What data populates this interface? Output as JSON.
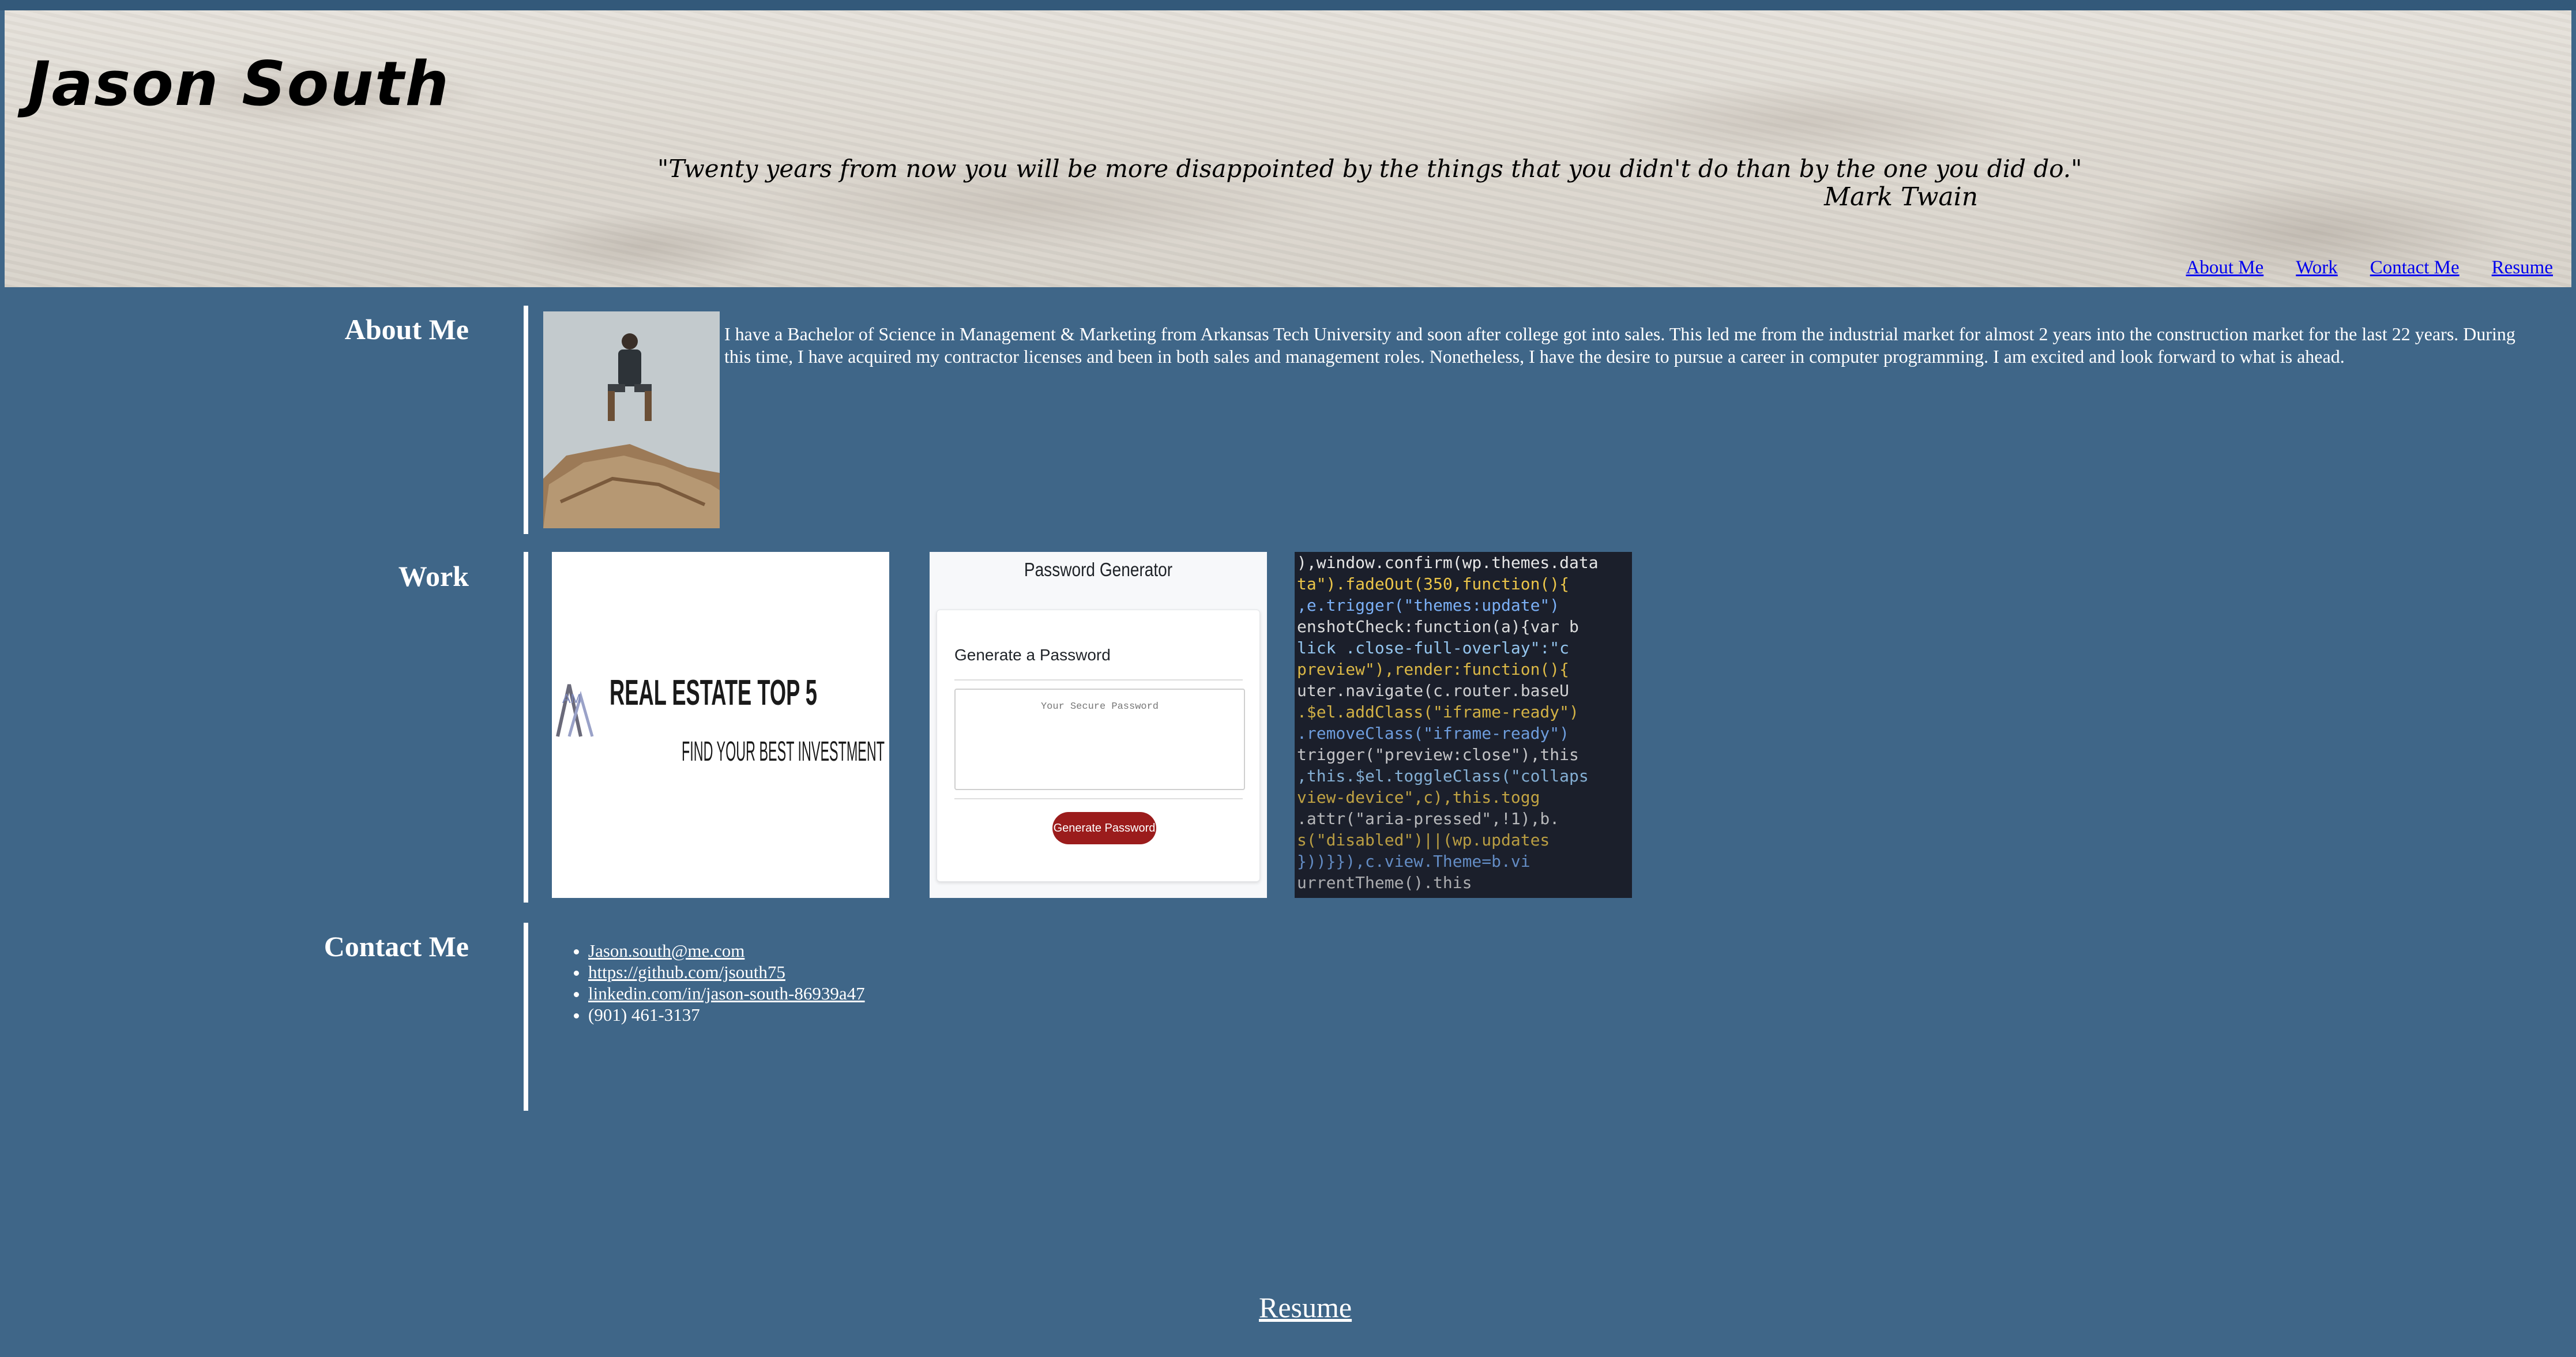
{
  "header": {
    "title": "Jason South",
    "quote": "\"Twenty years from now you will be more disappointed by the things that you didn't do than by the one you did do.\"",
    "quote_author": "Mark Twain"
  },
  "nav": {
    "items": [
      {
        "label": "About Me"
      },
      {
        "label": "Work"
      },
      {
        "label": "Contact Me"
      },
      {
        "label": "Resume"
      }
    ]
  },
  "about": {
    "heading": "About Me",
    "text": "I have a Bachelor of Science in Management & Marketing from Arkansas Tech University and soon after college got into sales. This led me from the industrial market for almost 2 years into the construction market for the last 22 years. During this time, I have acquired my contractor licenses and been in both sales and management roles. Nonetheless, I have the desire to pursue a career in computer programming. I am excited and look forward to what is ahead."
  },
  "work": {
    "heading": "Work",
    "projects": [
      {
        "title": "REAL ESTATE TOP 5",
        "subtitle": "FIND YOUR BEST INVESTMENT",
        "logo_text": "AM"
      },
      {
        "title": "Password Generator",
        "card_heading": "Generate a Password",
        "placeholder": "Your Secure Password",
        "button_label": "Generate Password",
        "button_color": "#9b1c1c"
      },
      {
        "code_lines": [
          "),window.confirm(wp.themes.data",
          "ta\").fadeOut(350,function(){",
          ",e.trigger(\"themes:update\")",
          "enshotCheck:function(a){var b",
          "lick .close-full-overlay\":\"c",
          "preview\"),render:function(){",
          "uter.navigate(c.router.baseU",
          ".$el.addClass(\"iframe-ready\")",
          ".removeClass(\"iframe-ready\")",
          "trigger(\"preview:close\"),this",
          ",this.$el.toggleClass(\"collaps",
          "view-device\",c),this.togg",
          ".attr(\"aria-pressed\",!1),b.",
          "s(\"disabled\")||(wp.updates",
          "}))}}),c.view.Theme=b.vi",
          "urrentTheme().this"
        ]
      }
    ]
  },
  "contact": {
    "heading": "Contact Me",
    "email": "Jason.south@me.com",
    "github": "https://github.com/jsouth75",
    "linkedin": "linkedin.com/in/jason-south-86939a47",
    "phone": "(901) 461-3137"
  },
  "footer": {
    "resume_label": "Resume"
  },
  "colors": {
    "page_background": "#3f6688",
    "nav_link": "#0000ee",
    "text": "#ffffff"
  }
}
